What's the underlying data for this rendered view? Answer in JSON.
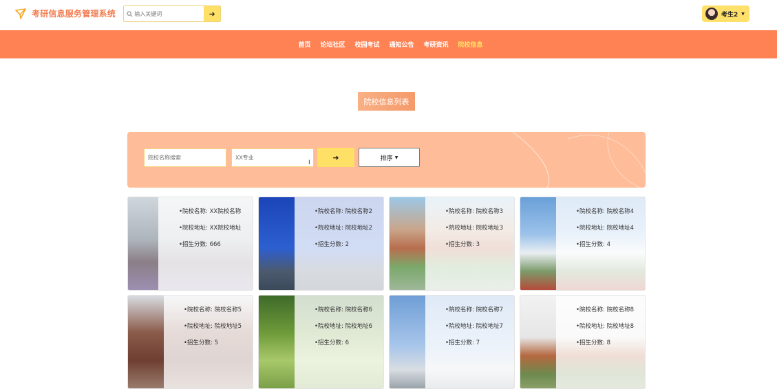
{
  "header": {
    "app_title": "考研信息服务管理系统",
    "search_placeholder": "输入关键词",
    "user_name": "考生2"
  },
  "nav": {
    "items": [
      "首页",
      "论坛社区",
      "校园考试",
      "通知公告",
      "考研资讯",
      "院校信息"
    ],
    "active_index": 5
  },
  "section_title": "院校信息列表",
  "filter": {
    "school_name_placeholder": "院校名称搜索",
    "major_value": "XX专业",
    "sort_label": "排序"
  },
  "colors": {
    "brand_orange": "#ff8254",
    "accent_yellow": "#ffe066",
    "filter_bg": "#ffbc98"
  },
  "icons": {
    "logo": "paper-plane-icon",
    "search": "search-icon",
    "submit": "arrow-right-icon"
  },
  "cards": [
    {
      "name": "院校名称: XX院校名称",
      "address": "院校地址: XX院校地址",
      "score": "招生分数: 666"
    },
    {
      "name": "院校名称: 院校名称2",
      "address": "院校地址: 院校地址2",
      "score": "招生分数: 2"
    },
    {
      "name": "院校名称: 院校名称3",
      "address": "院校地址: 院校地址3",
      "score": "招生分数: 3"
    },
    {
      "name": "院校名称: 院校名称4",
      "address": "院校地址: 院校地址4",
      "score": "招生分数: 4"
    },
    {
      "name": "院校名称: 院校名称5",
      "address": "院校地址: 院校地址5",
      "score": "招生分数: 5"
    },
    {
      "name": "院校名称: 院校名称6",
      "address": "院校地址: 院校地址6",
      "score": "招生分数: 6"
    },
    {
      "name": "院校名称: 院校名称7",
      "address": "院校地址: 院校地址7",
      "score": "招生分数: 7"
    },
    {
      "name": "院校名称: 院校名称8",
      "address": "院校地址: 院校地址8",
      "score": "招生分数: 8"
    }
  ]
}
